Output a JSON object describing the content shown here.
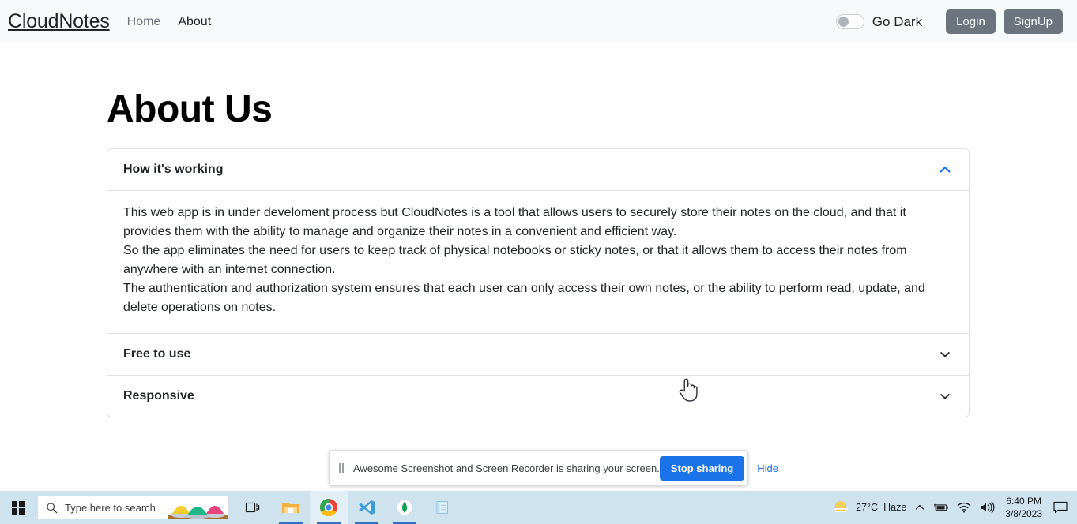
{
  "navbar": {
    "brand": "CloudNotes",
    "links": [
      {
        "label": "Home",
        "active": false
      },
      {
        "label": "About",
        "active": true
      }
    ],
    "theme_toggle": {
      "label": "Go Dark",
      "state": "off",
      "icon": "toggle-switch-icon"
    },
    "login_label": "Login",
    "signup_label": "SignUp",
    "button_color": "#6c757d",
    "background": "#f8f9fa"
  },
  "main": {
    "page_title": "About Us",
    "accordion": {
      "accent_color": "#0d6efd",
      "items": [
        {
          "title": "How it's working",
          "expanded": true,
          "icon": "chevron-up-icon",
          "paragraphs": [
            "This web app is in under develoment process but CloudNotes is a tool that allows users to securely store their notes on the cloud, and that it provides them with the ability to manage and organize their notes in a convenient and efficient way.",
            "So the app eliminates the need for users to keep track of physical notebooks or sticky notes, or that it allows them to access their notes from anywhere with an internet connection.",
            "The authentication and authorization system ensures that each user can only access their own notes, or the ability to perform read, update, and delete operations on notes."
          ]
        },
        {
          "title": "Free to use",
          "expanded": false,
          "icon": "chevron-down-icon",
          "paragraphs": []
        },
        {
          "title": "Responsive",
          "expanded": false,
          "icon": "chevron-down-icon",
          "paragraphs": []
        }
      ]
    }
  },
  "share_bar": {
    "pause_icon": "pause-icon",
    "message": "Awesome Screenshot and Screen Recorder is sharing your screen.",
    "stop_label": "Stop sharing",
    "hide_label": "Hide",
    "accent_color": "#1a73e8"
  },
  "taskbar": {
    "start_icon": "windows-start-icon",
    "search_placeholder": "Type here to search",
    "search_icon": "search-icon",
    "apps": [
      {
        "name": "task-view-icon",
        "active": false,
        "running": false
      },
      {
        "name": "file-explorer-icon",
        "active": false,
        "running": true
      },
      {
        "name": "google-chrome-icon",
        "active": true,
        "running": true
      },
      {
        "name": "vs-code-icon",
        "active": false,
        "running": true
      },
      {
        "name": "mongodb-compass-icon",
        "active": false,
        "running": true
      },
      {
        "name": "notepad-icon",
        "active": false,
        "running": false
      }
    ],
    "tray": {
      "weather_icon": "haze-sun-icon",
      "temperature": "27°C",
      "condition": "Haze",
      "overflow_icon": "chevron-up-icon",
      "battery_icon": "battery-icon",
      "wifi_icon": "wifi-icon",
      "volume_icon": "volume-icon",
      "time": "6:40 PM",
      "date": "3/8/2023",
      "notifications_icon": "notification-icon"
    }
  },
  "cursor": {
    "type": "pointing-hand-cursor"
  }
}
